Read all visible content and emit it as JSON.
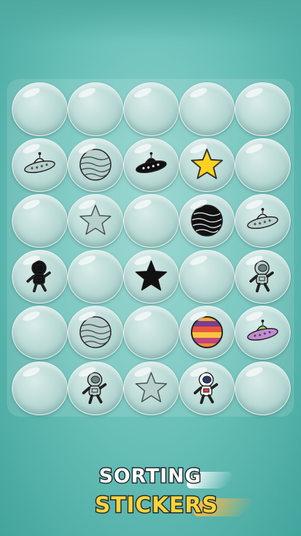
{
  "game": {
    "title_line1": "SORTING",
    "title_line2": "STICKERS",
    "colors": {
      "background": "#6cc2bb",
      "bubble": "#b7d8d4",
      "title_white": "#ffffff",
      "title_yellow": "#ffd23c"
    }
  },
  "grid": {
    "rows": 6,
    "cols": 5,
    "cells": [
      [
        null,
        null,
        null,
        null,
        null
      ],
      [
        "ufo-outline-icon",
        "planet-outline-icon",
        "ufo-black-icon",
        "star-yellow-icon",
        null
      ],
      [
        null,
        "star-outline-icon",
        null,
        "planet-black-icon",
        "ufo-outline-icon"
      ],
      [
        "astronaut-black-icon",
        null,
        "star-black-icon",
        null,
        "astronaut-outline-icon"
      ],
      [
        null,
        "planet-outline-icon",
        null,
        "planet-color-icon",
        "ufo-color-icon"
      ],
      [
        null,
        "astronaut-outline-icon",
        "star-outline-icon",
        "astronaut-color-icon",
        null
      ]
    ]
  }
}
